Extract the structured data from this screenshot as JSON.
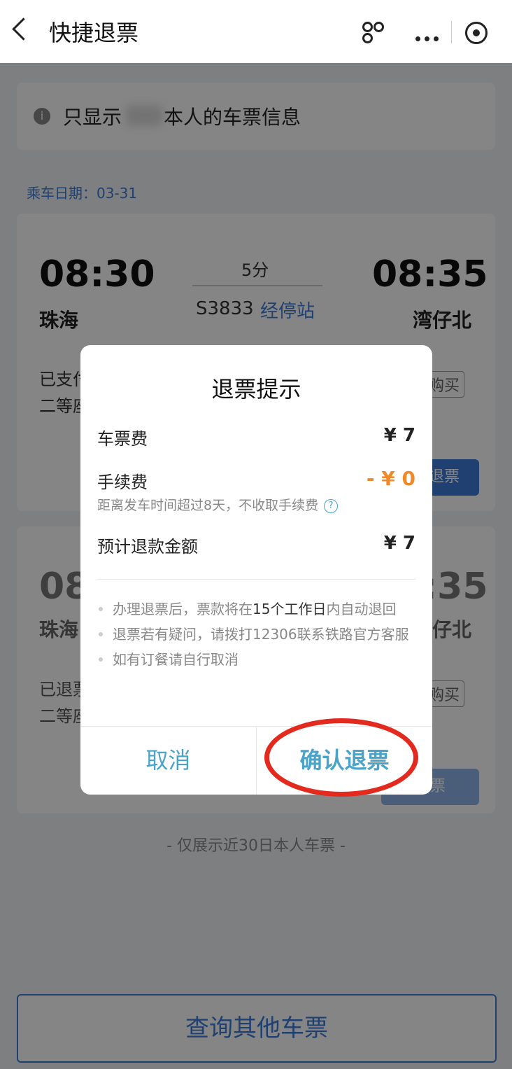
{
  "nav": {
    "title": "快捷退票"
  },
  "notice": {
    "text_before": "只显示",
    "text_after": "本人的车票信息"
  },
  "date_label": "乘车日期：03-31",
  "ticket1": {
    "dep_time": "08:30",
    "dep_station": "珠海",
    "duration": "5分",
    "train_no": "S3833",
    "stops_link": "经停站",
    "arr_time": "08:35",
    "arr_station": "湾仔北",
    "status": "已支付",
    "seat": "二等座",
    "rebuy": "购买",
    "action": "退票"
  },
  "ticket2": {
    "dep_time": "08:30",
    "dep_station": "珠海",
    "arr_time": "08:35",
    "arr_station": "湾仔北",
    "status": "已退票",
    "seat": "二等座",
    "rebuy": "购买",
    "action": "退票"
  },
  "footer_note": "- 仅展示近30日本人车票 -",
  "query_button": "查询其他车票",
  "dialog": {
    "title": "退票提示",
    "ticket_fee_label": "车票费",
    "ticket_fee_value": "¥ 7",
    "service_fee_label": "手续费",
    "service_fee_value": "- ¥ 0",
    "service_fee_note": "距离发车时间超过8天，不收取手续费",
    "refund_label": "预计退款金额",
    "refund_value": "¥ 7",
    "bullet1_a": "办理退票后，票款将在",
    "bullet1_b": "15个工作日",
    "bullet1_c": "内自动退回",
    "bullet2": "退票若有疑问，请拨打12306联系铁路官方客服",
    "bullet3": "如有订餐请自行取消",
    "cancel": "取消",
    "confirm": "确认退票"
  },
  "colors": {
    "accent": "#3d7bd6",
    "dialog_link": "#4aa3c8",
    "fee": "#ef8a2b",
    "highlight_ring": "#e32a1f"
  }
}
